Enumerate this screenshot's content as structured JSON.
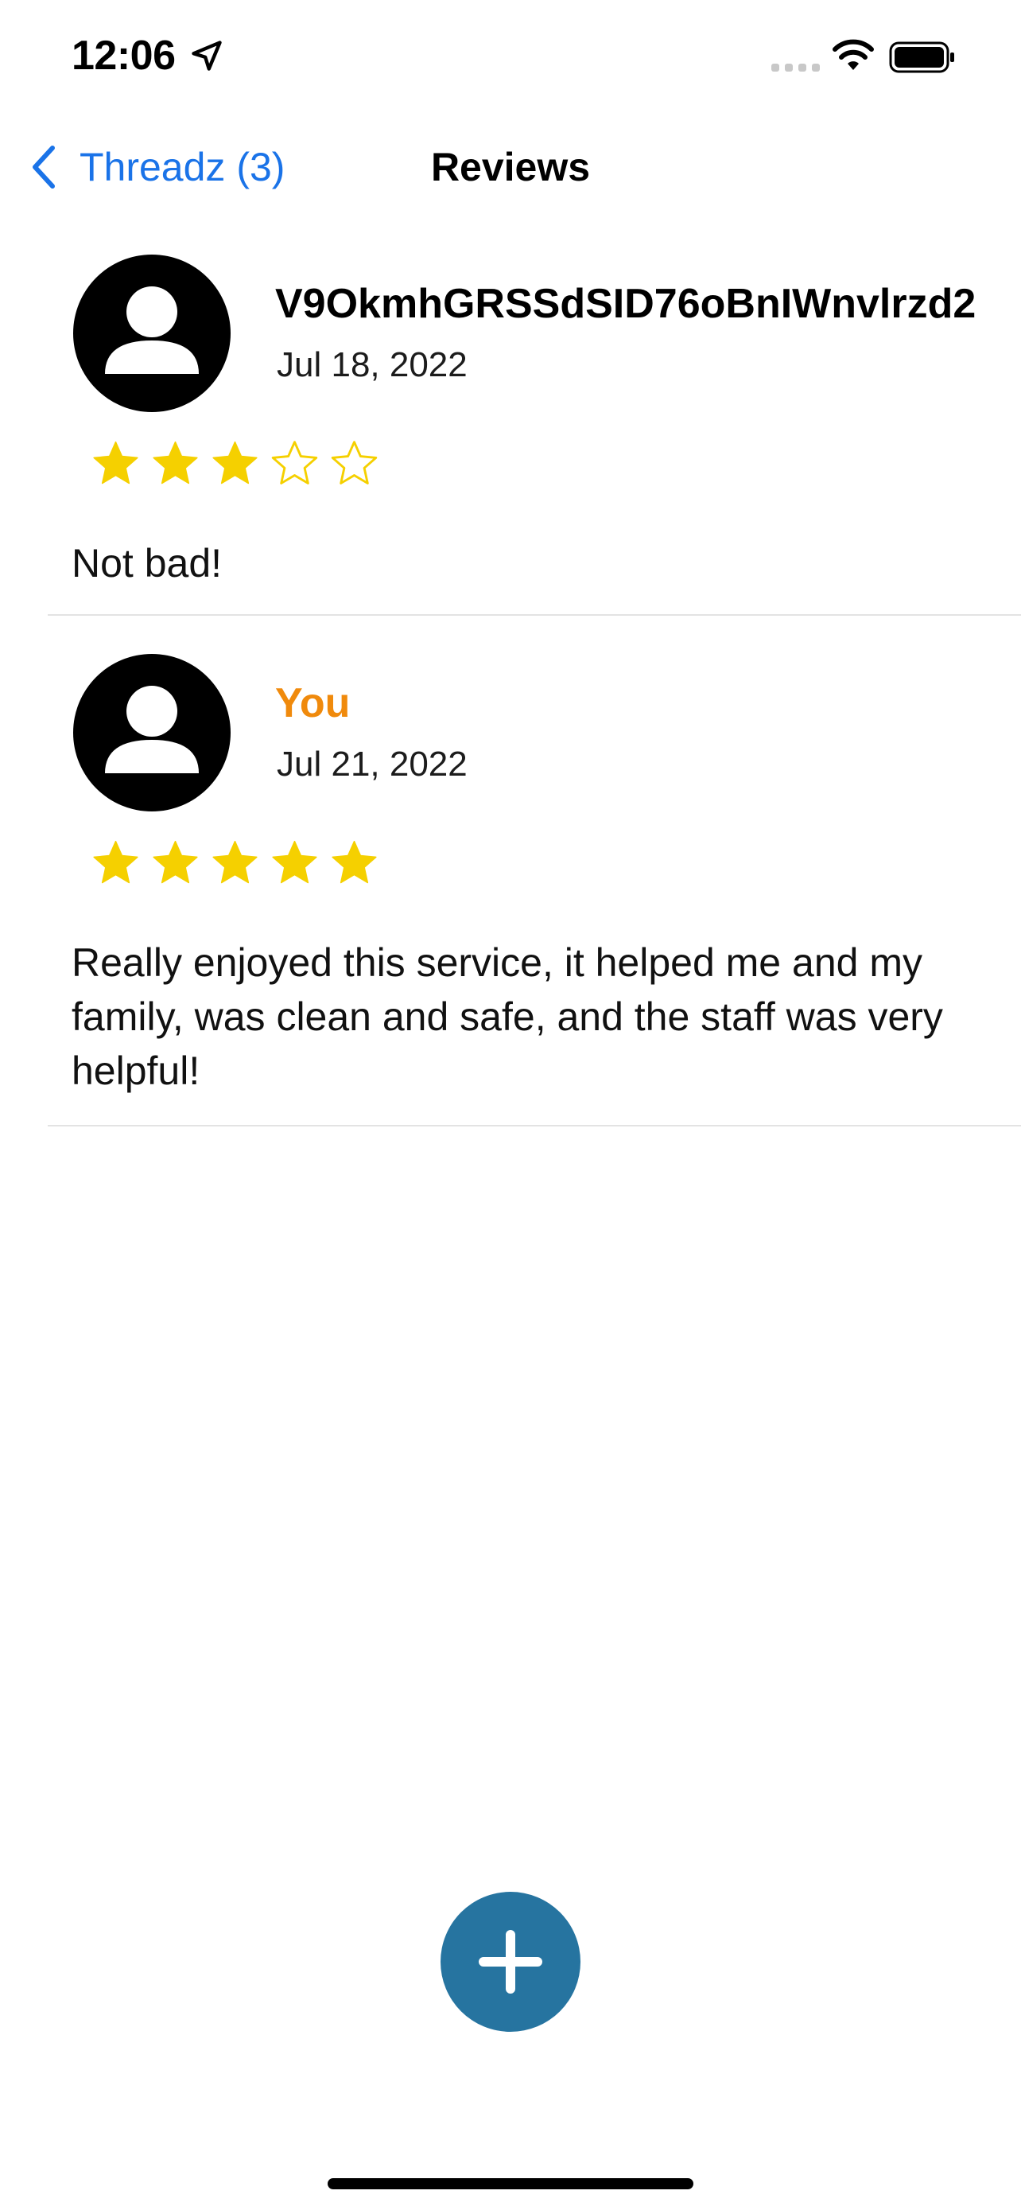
{
  "status_bar": {
    "time": "12:06",
    "icons": [
      "location-arrow-icon",
      "signal-icon",
      "wifi-icon",
      "battery-icon"
    ]
  },
  "nav": {
    "back_label": "Threadz (3)",
    "title": "Reviews",
    "accent_color": "#1a73e8"
  },
  "reviews": [
    {
      "name": "V9OkmhGRSSdSID76oBnIWnvlrzd2",
      "date": "Jul 18, 2022",
      "rating": 3,
      "max_rating": 5,
      "text": "Not bad!"
    },
    {
      "name": "You",
      "date": "Jul 21, 2022",
      "rating": 5,
      "max_rating": 5,
      "text": "Really enjoyed this service, it helped me and my family, was clean and safe, and the staff was very helpful!",
      "name_color": "#f08a0c"
    }
  ],
  "fab": {
    "icon": "plus-icon",
    "color": "#2674a0"
  },
  "colors": {
    "star": "#f5d000",
    "divider": "#e3e3e3"
  }
}
